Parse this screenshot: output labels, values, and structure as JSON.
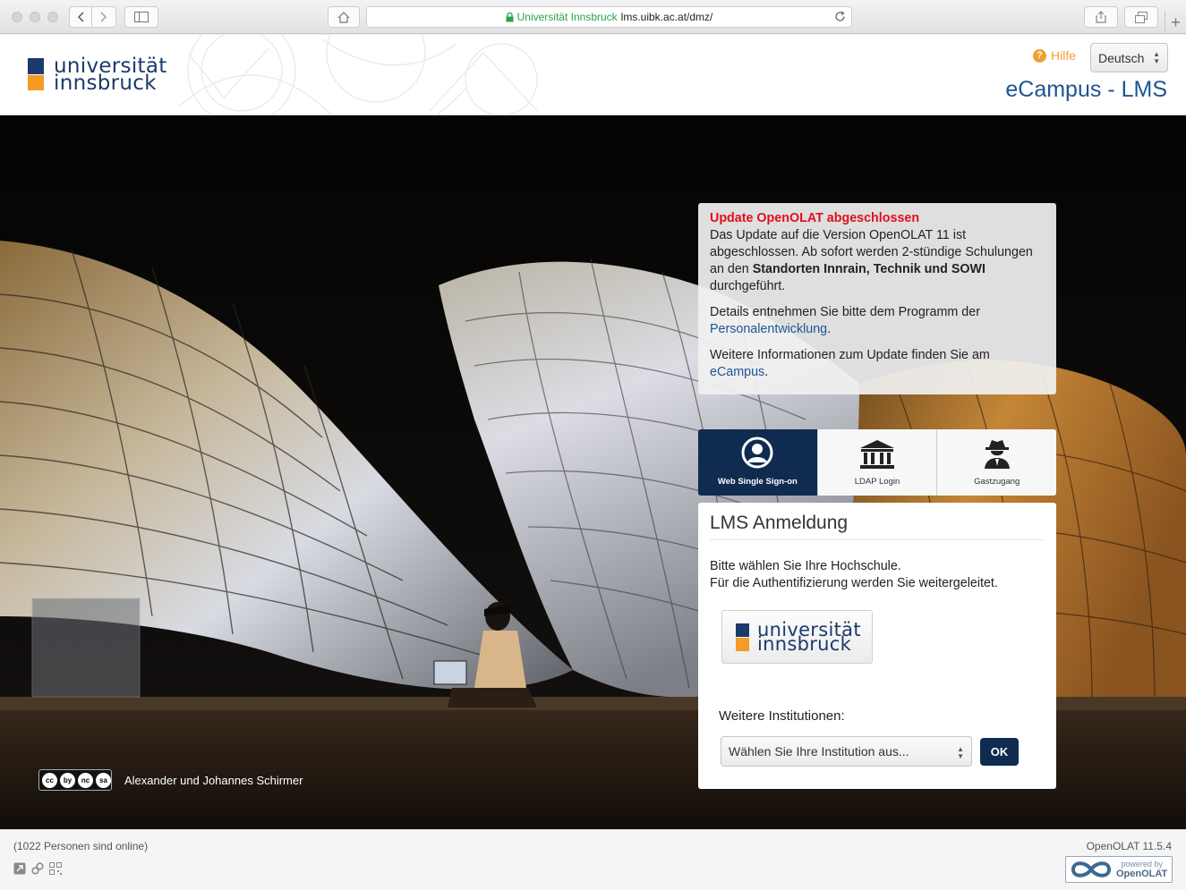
{
  "browser": {
    "url_secure_label": "Universität Innsbruck",
    "url_domain": "lms.uibk.ac.at/dmz/",
    "new_tab": "+"
  },
  "header": {
    "logo_line1": "universität",
    "logo_line2": "innsbruck",
    "help_label": "Hilfe",
    "language": "Deutsch",
    "app_title": "eCampus - LMS"
  },
  "hero": {
    "credit": "Alexander und Johannes Schirmer",
    "license_icons": [
      "cc",
      "by",
      "nc",
      "sa"
    ]
  },
  "notice": {
    "title": "Update OpenOLAT abgeschlossen",
    "p1_text": "Das Update auf die Version OpenOLAT 11 ist abgeschlossen. Ab sofort werden 2-stündige Schulungen an den ",
    "p1_bold": "Standorten Innrain, Technik und SOWI",
    "p1_end": " durchgeführt.",
    "p2_text": "Details entnehmen Sie bitte dem Programm der ",
    "p2_link": "Personalentwicklung",
    "p2_end": ".",
    "p3_text": "Weitere Informationen zum Update finden Sie am ",
    "p3_link": "eCampus",
    "p3_end": "."
  },
  "login_tabs": [
    {
      "label": "Web Single Sign-on",
      "icon": "user-circle-icon",
      "active": true
    },
    {
      "label": "LDAP Login",
      "icon": "institution-icon",
      "active": false
    },
    {
      "label": "Gastzugang",
      "icon": "user-secret-icon",
      "active": false
    }
  ],
  "login": {
    "title": "LMS Anmeldung",
    "desc_line1": "Bitte wählen Sie Ihre Hochschule.",
    "desc_line2": "Für die Authentifizierung werden Sie weitergeleitet.",
    "uni_line1": "universität",
    "uni_line2": "innsbruck",
    "more_label": "Weitere Institutionen:",
    "select_placeholder": "Wählen Sie Ihre Institution aus...",
    "ok_label": "OK"
  },
  "footer": {
    "online": "(1022 Personen sind online)",
    "version": "OpenOLAT 11.5.4",
    "powered_line1": "powered by",
    "powered_line2": "OpenOLAT"
  },
  "colors": {
    "brand_blue": "#1b3a6b",
    "brand_orange": "#f59a23",
    "dark_button": "#0f2b4f",
    "alert_red": "#e20f1d",
    "link_blue": "#1f5493"
  }
}
